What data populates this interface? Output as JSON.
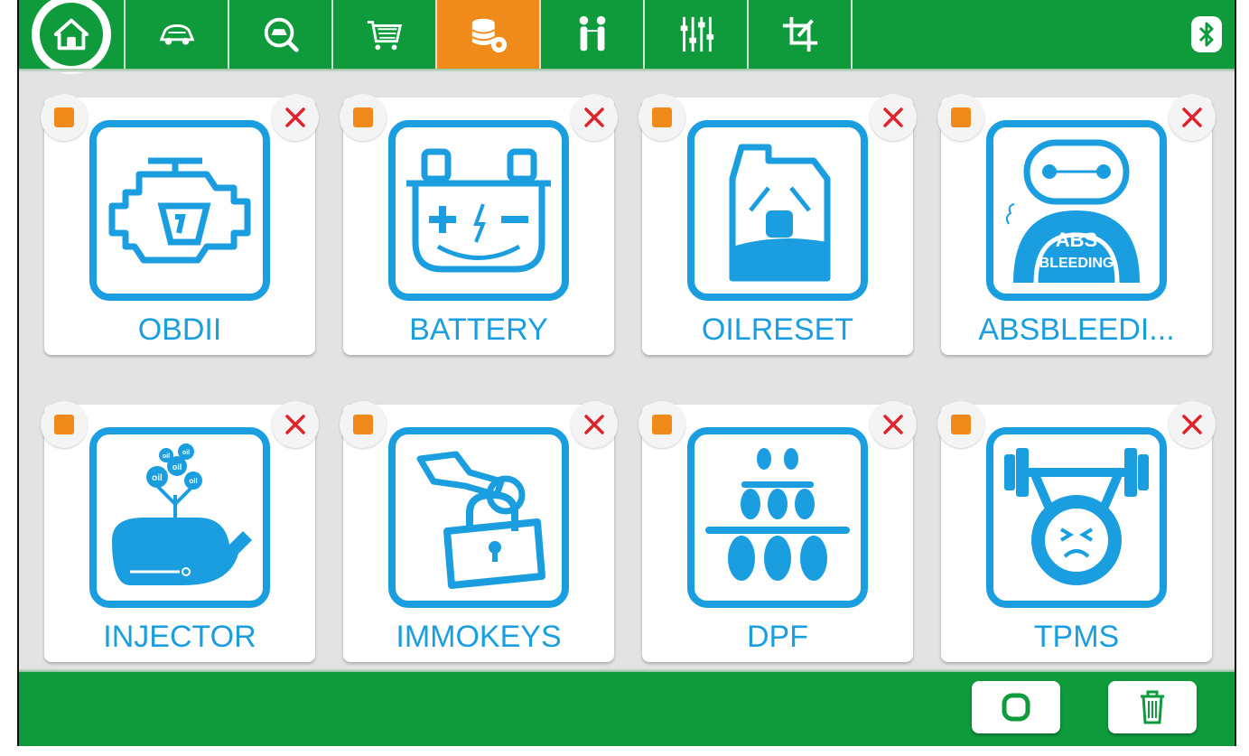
{
  "top_tabs": [
    {
      "icon": "home-icon",
      "active": false
    },
    {
      "icon": "car-icon",
      "active": false
    },
    {
      "icon": "car-search-icon",
      "active": false
    },
    {
      "icon": "shopping-cart-icon",
      "active": false
    },
    {
      "icon": "database-settings-icon",
      "active": true
    },
    {
      "icon": "people-icon",
      "active": false
    },
    {
      "icon": "sliders-icon",
      "active": false
    },
    {
      "icon": "crop-icon",
      "active": false
    }
  ],
  "status": {
    "bluetooth_icon": "bluetooth-icon"
  },
  "apps": [
    {
      "label": "OBDII",
      "icon": "engine-icon"
    },
    {
      "label": "BATTERY",
      "icon": "battery-icon"
    },
    {
      "label": "OILRESET",
      "icon": "oil-can-icon"
    },
    {
      "label": "ABSBLEEDI...",
      "icon": "abs-bleeding-icon",
      "icon_text": [
        "ABS",
        "BLEEDING"
      ]
    },
    {
      "label": "INJECTOR",
      "icon": "whale-injector-icon",
      "icon_text": [
        "oil",
        "oil",
        "oil",
        "oil",
        "oil"
      ]
    },
    {
      "label": "IMMOKEYS",
      "icon": "key-lock-icon"
    },
    {
      "label": "DPF",
      "icon": "dpf-filter-icon"
    },
    {
      "label": "TPMS",
      "icon": "tire-lift-icon"
    }
  ],
  "bottom": {
    "select_all_icon": "select-all-icon",
    "delete_icon": "trash-icon"
  },
  "colors": {
    "green": "#0f9a3c",
    "orange": "#f08a1a",
    "blue": "#1b9ee0",
    "red": "#e0232a"
  }
}
